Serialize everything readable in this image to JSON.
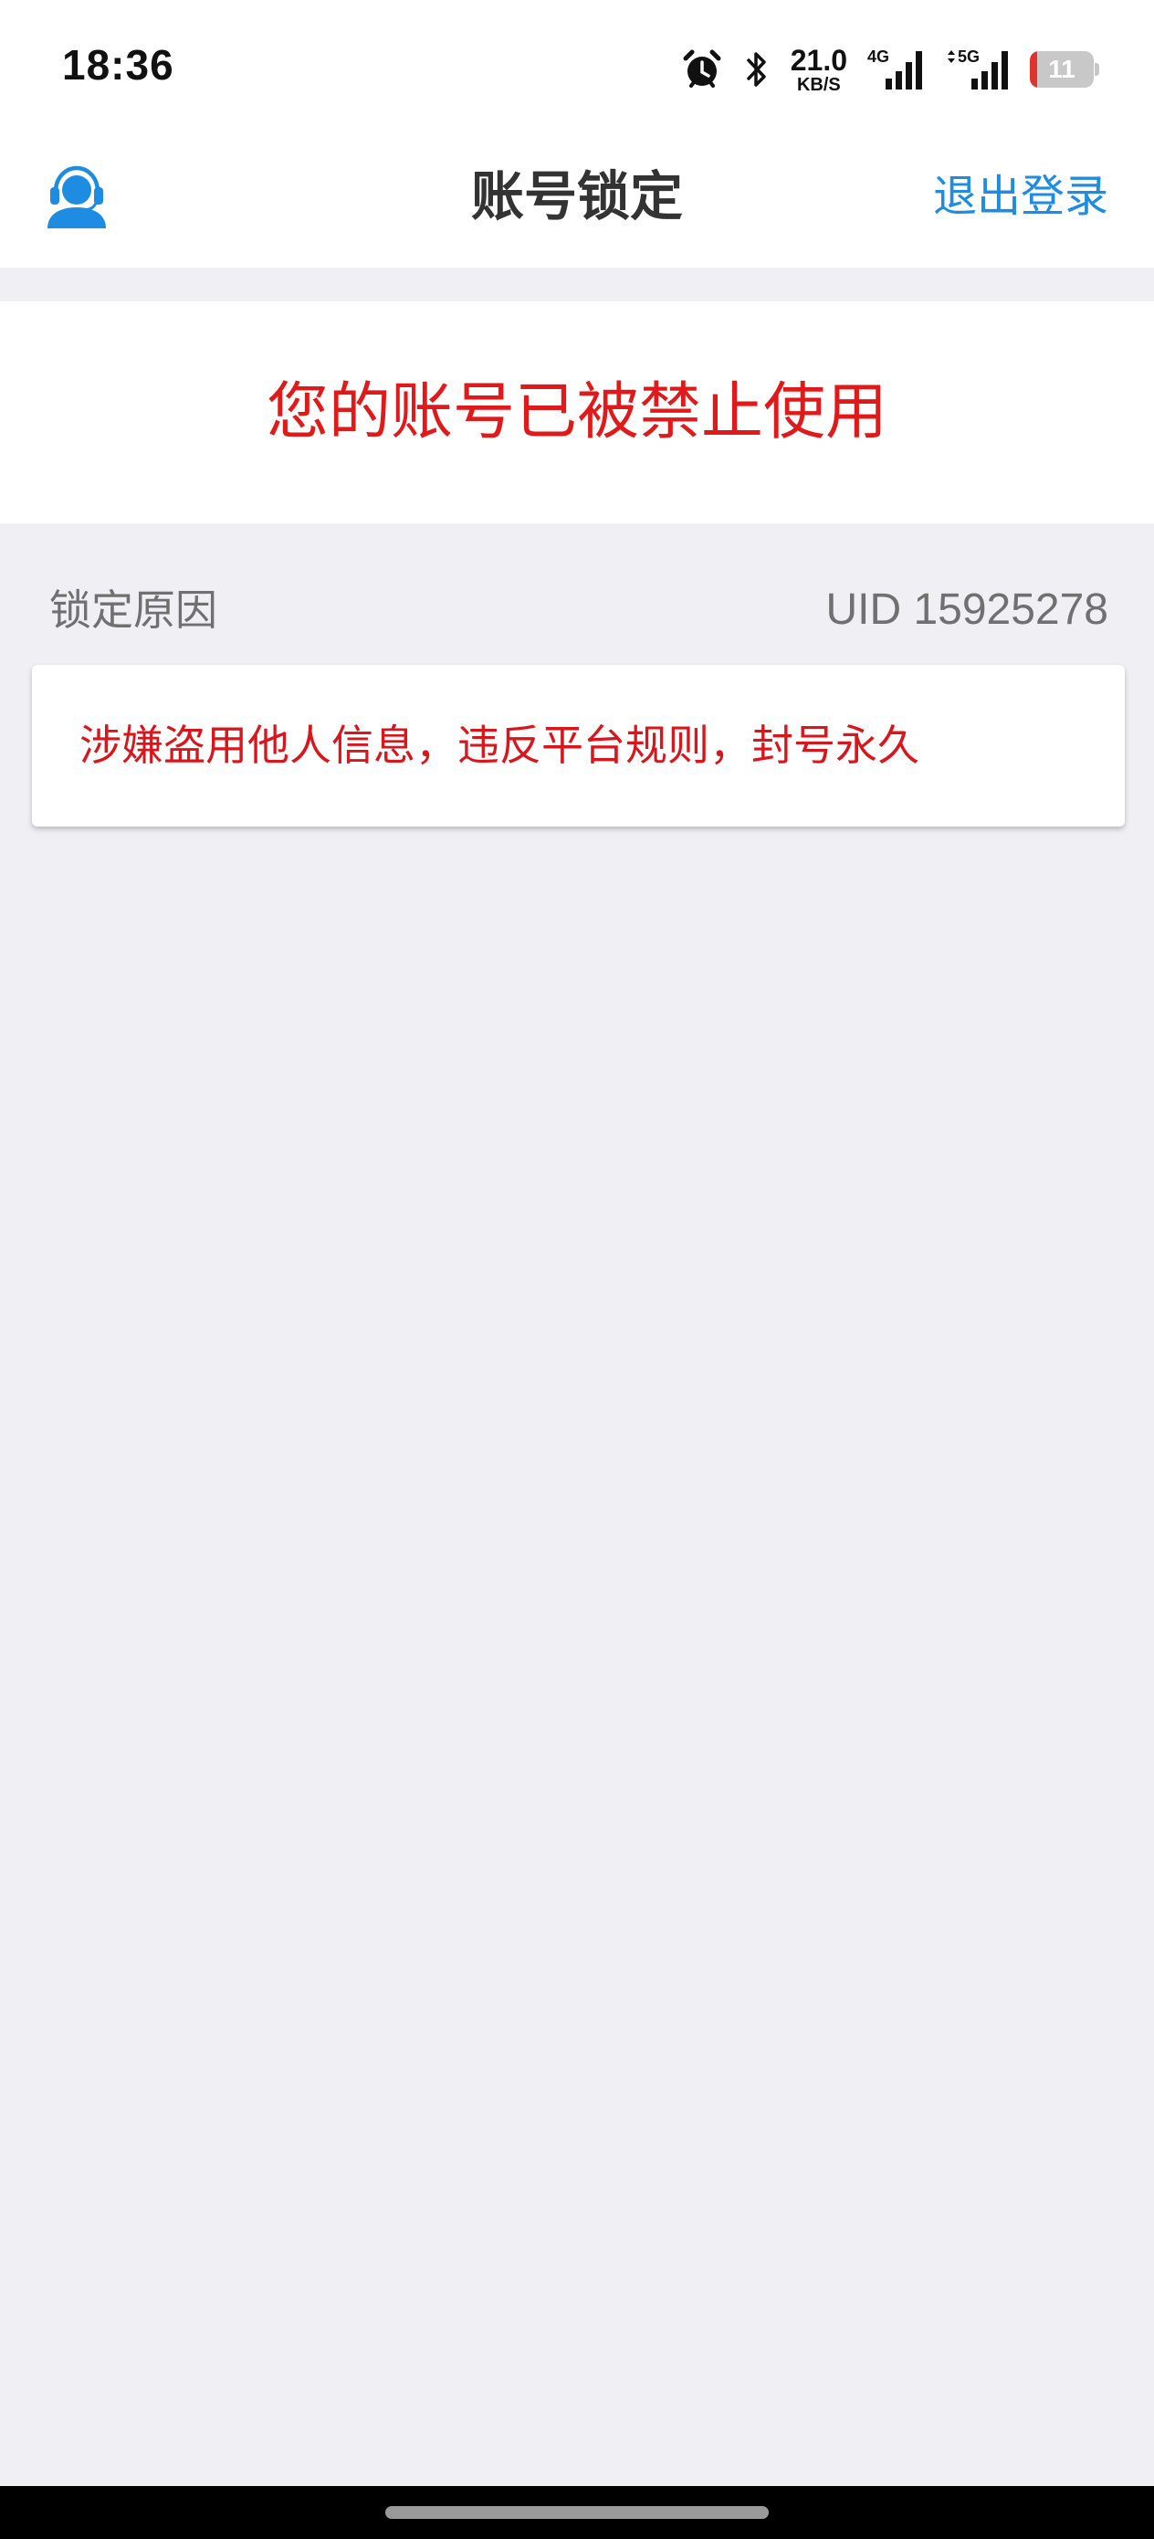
{
  "status_bar": {
    "time": "18:36",
    "net_speed_value": "21.0",
    "net_speed_unit": "KB/S",
    "signal_1_label": "4G",
    "signal_2_label": "5G",
    "battery_level": "11",
    "battery_level_fraction": 0.11,
    "battery_color": "#e0332e"
  },
  "nav": {
    "title": "账号锁定",
    "left_icon": "customer-service-icon",
    "logout_label": "退出登录"
  },
  "banner": {
    "message": "您的账号已被禁止使用"
  },
  "reason": {
    "label": "锁定原因",
    "uid": "UID 15925278",
    "text": "涉嫌盗用他人信息，违反平台规则，封号永久"
  },
  "colors": {
    "accent": "#1e8ce0",
    "alert": "#e01a1a",
    "background": "#efeff4"
  }
}
